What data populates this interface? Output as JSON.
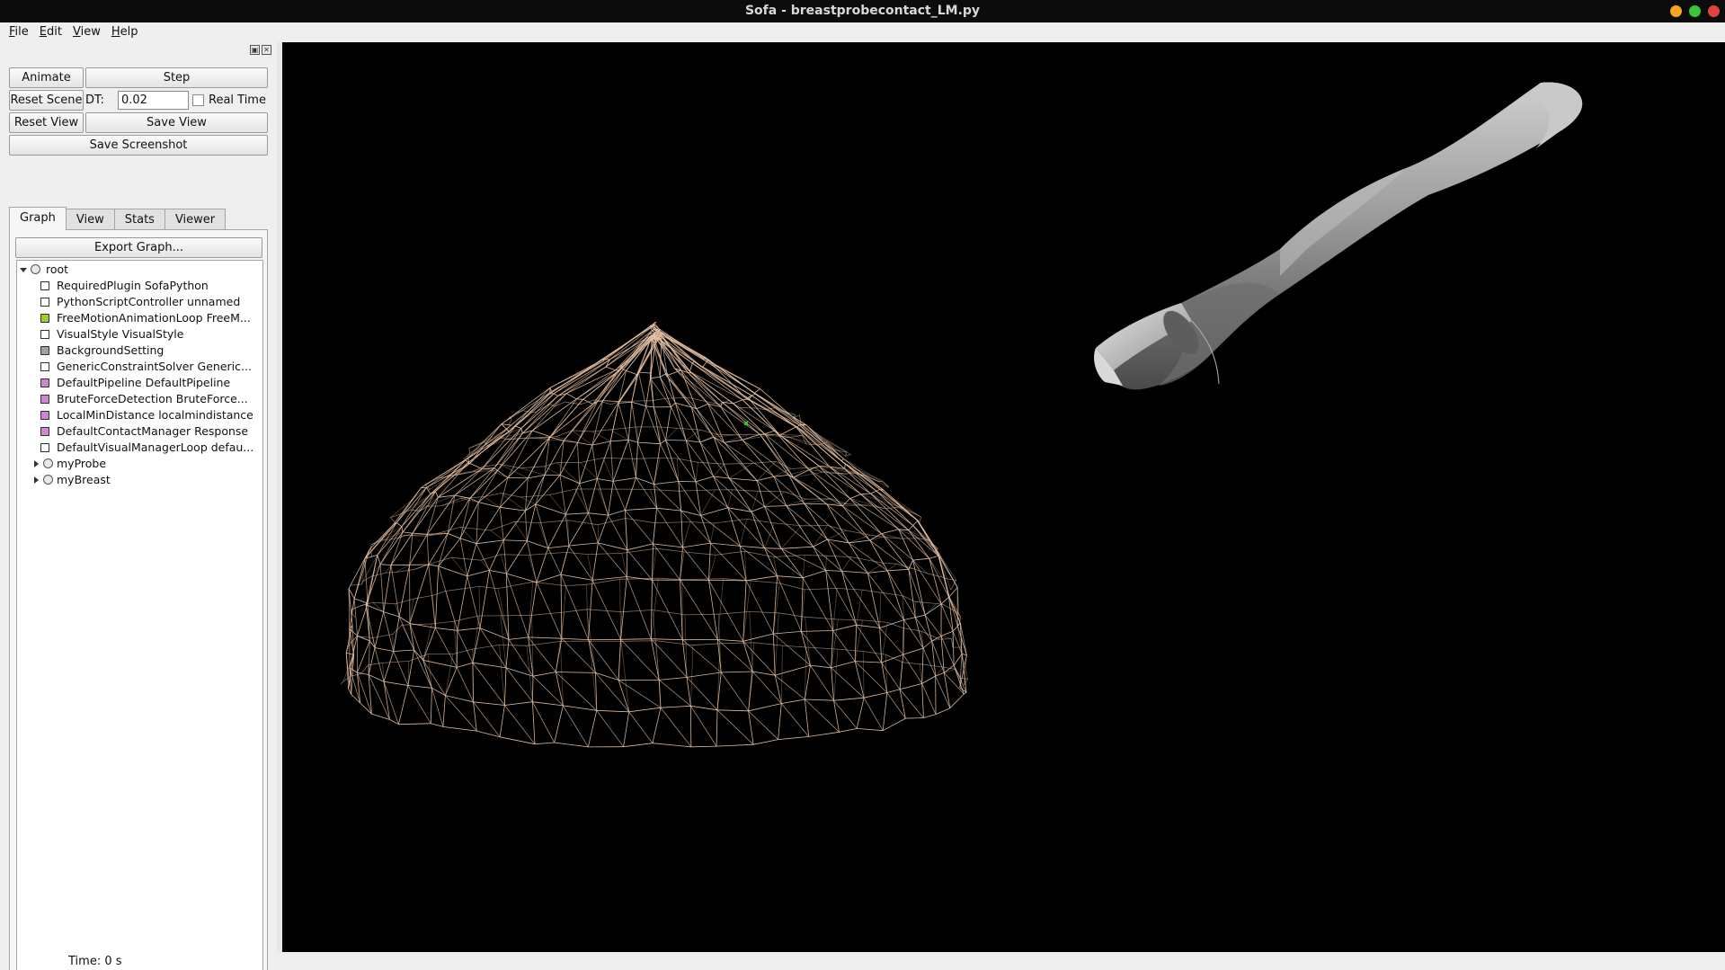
{
  "window": {
    "title": "Sofa - breastprobecontact_LM.py"
  },
  "menu": [
    {
      "label": "File",
      "mnemonic": "F",
      "rest": "ile"
    },
    {
      "label": "Edit",
      "mnemonic": "E",
      "rest": "dit"
    },
    {
      "label": "View",
      "mnemonic": "V",
      "rest": "iew"
    },
    {
      "label": "Help",
      "mnemonic": "H",
      "rest": "elp"
    }
  ],
  "controls": {
    "animate": "Animate",
    "step": "Step",
    "reset_scene": "Reset Scene",
    "dt_label": "DT:",
    "dt_value": "0.02",
    "real_time": "Real Time",
    "reset_view": "Reset View",
    "save_view": "Save View",
    "save_screenshot": "Save Screenshot"
  },
  "tabs": [
    "Graph",
    "View",
    "Stats",
    "Viewer"
  ],
  "export_graph": "Export Graph...",
  "tree": [
    {
      "label": "root",
      "kind": "node",
      "expanded": true,
      "level": 0
    },
    {
      "label": "RequiredPlugin SofaPython",
      "kind": "object",
      "color": "#ffffff",
      "level": 1
    },
    {
      "label": "PythonScriptController unnamed",
      "kind": "object",
      "color": "#ffffff",
      "level": 1
    },
    {
      "label": "FreeMotionAnimationLoop FreeM...",
      "kind": "object",
      "color": "#9acd32",
      "level": 1
    },
    {
      "label": "VisualStyle VisualStyle",
      "kind": "object",
      "color": "#ffffff",
      "level": 1
    },
    {
      "label": "BackgroundSetting",
      "kind": "object",
      "color": "#a0a0a0",
      "level": 1
    },
    {
      "label": "GenericConstraintSolver Generic...",
      "kind": "object",
      "color": "#ffffff",
      "level": 1
    },
    {
      "label": "DefaultPipeline DefaultPipeline",
      "kind": "object",
      "color": "#cc88cc",
      "level": 1
    },
    {
      "label": "BruteForceDetection BruteForce...",
      "kind": "object",
      "color": "#cc88cc",
      "level": 1
    },
    {
      "label": "LocalMinDistance localmindistance",
      "kind": "object",
      "color": "#cc88cc",
      "level": 1
    },
    {
      "label": "DefaultContactManager Response",
      "kind": "object",
      "color": "#cc88cc",
      "level": 1
    },
    {
      "label": "DefaultVisualManagerLoop defau...",
      "kind": "object",
      "color": "#ffffff",
      "level": 1
    },
    {
      "label": "myProbe",
      "kind": "node",
      "expanded": false,
      "level": 1
    },
    {
      "label": "myBreast",
      "kind": "node",
      "expanded": false,
      "level": 1
    }
  ],
  "status": {
    "time": "Time: 0 s"
  },
  "colors": {
    "wm_minimize": "#f5a623",
    "wm_maximize": "#3cc43c",
    "wm_close": "#e0443e",
    "mesh": "#e8c4a6",
    "probe": "#8a8a8a",
    "marker": "#22cc22"
  }
}
